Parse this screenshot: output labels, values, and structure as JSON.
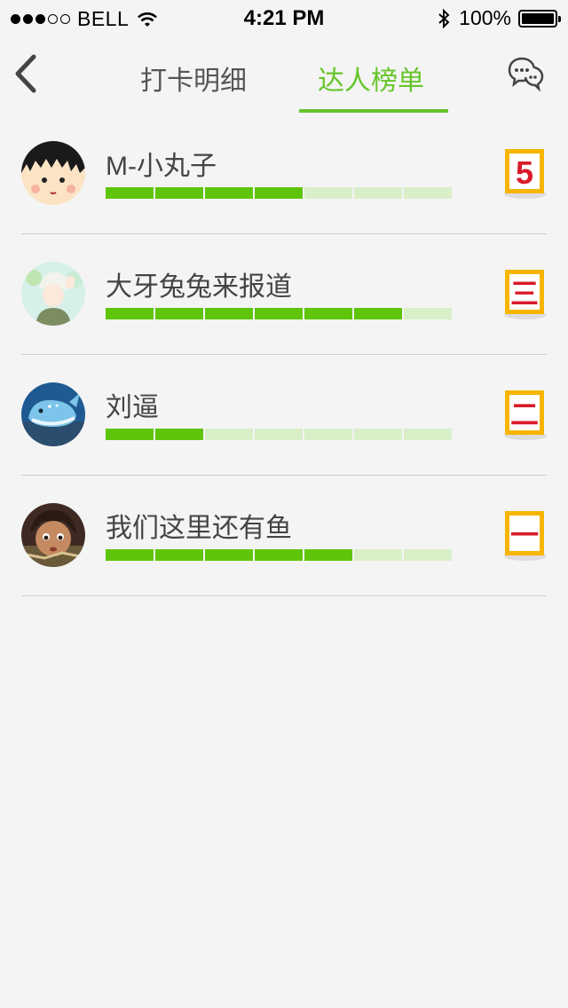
{
  "status_bar": {
    "carrier": "BELL",
    "time": "4:21 PM",
    "battery": "100%",
    "signal_bars_filled": 3,
    "signal_bars_total": 5
  },
  "nav": {
    "tabs": [
      {
        "label": "打卡明细",
        "active": false
      },
      {
        "label": "达人榜单",
        "active": true
      }
    ],
    "accent_color": "#66c52a"
  },
  "ranking": [
    {
      "name": "M-小丸子",
      "progress_filled": 4,
      "progress_total": 7,
      "badge": "5"
    },
    {
      "name": "大牙兔兔来报道",
      "progress_filled": 6,
      "progress_total": 7,
      "badge": "三"
    },
    {
      "name": "刘逼",
      "progress_filled": 2,
      "progress_total": 7,
      "badge": "二"
    },
    {
      "name": "我们这里还有鱼",
      "progress_filled": 5,
      "progress_total": 7,
      "badge": "一"
    }
  ]
}
